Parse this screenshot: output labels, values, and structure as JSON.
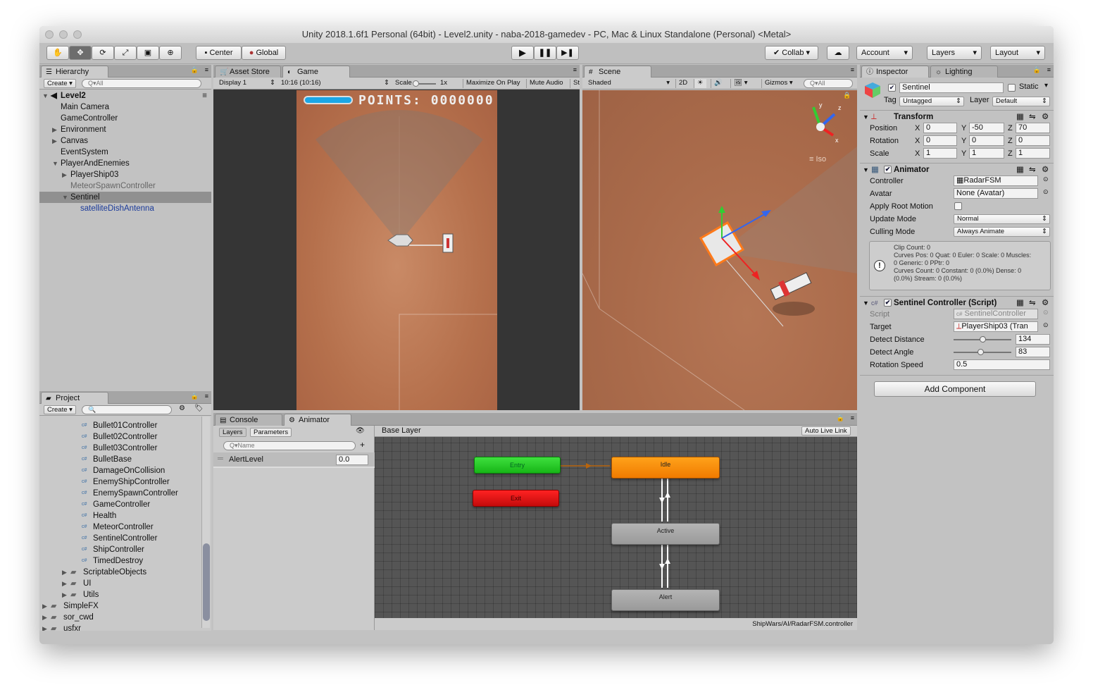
{
  "window": {
    "title": "Unity 2018.1.6f1 Personal (64bit) - Level2.unity - naba-2018-gamedev - PC, Mac & Linux Standalone (Personal) <Metal>"
  },
  "toolbar": {
    "center_label": "Center",
    "global_label": "Global",
    "collab_label": "Collab",
    "account_label": "Account",
    "layers_label": "Layers",
    "layout_label": "Layout"
  },
  "hierarchy": {
    "tab": "Hierarchy",
    "create": "Create",
    "search_placeholder": "Q▾All",
    "scene_name": "Level2",
    "items": [
      {
        "label": "Main Camera"
      },
      {
        "label": "GameController"
      },
      {
        "label": "Environment"
      },
      {
        "label": "Canvas"
      },
      {
        "label": "EventSystem"
      },
      {
        "label": "PlayerAndEnemies"
      },
      {
        "label": "PlayerShip03"
      },
      {
        "label": "MeteorSpawnController"
      },
      {
        "label": "Sentinel"
      },
      {
        "label": "satelliteDishAntenna"
      }
    ]
  },
  "project": {
    "tab": "Project",
    "create": "Create",
    "items": [
      {
        "label": "Bullet01Controller"
      },
      {
        "label": "Bullet02Controller"
      },
      {
        "label": "Bullet03Controller"
      },
      {
        "label": "BulletBase"
      },
      {
        "label": "DamageOnCollision"
      },
      {
        "label": "EnemyShipController"
      },
      {
        "label": "EnemySpawnController"
      },
      {
        "label": "GameController"
      },
      {
        "label": "Health"
      },
      {
        "label": "MeteorController"
      },
      {
        "label": "SentinelController"
      },
      {
        "label": "ShipController"
      },
      {
        "label": "TimedDestroy"
      },
      {
        "label": "ScriptableObjects"
      },
      {
        "label": "UI"
      },
      {
        "label": "Utils"
      },
      {
        "label": "SimpleFX"
      },
      {
        "label": "sor_cwd"
      },
      {
        "label": "usfxr"
      }
    ]
  },
  "game": {
    "tab_asset_store": "Asset Store",
    "tab_game": "Game",
    "display": "Display 1",
    "resolution": "10:16 (10:16)",
    "scale_label": "Scale",
    "scale_value": "1x",
    "maximize": "Maximize On Play",
    "mute": "Mute Audio",
    "stats": "St",
    "points_label": "POINTS:",
    "points_value": "0000000"
  },
  "scene": {
    "tab": "Scene",
    "shading": "Shaded",
    "mode_2d": "2D",
    "gizmos": "Gizmos",
    "search": "Q▾All",
    "view_mode": "Iso",
    "axis_y": "y",
    "axis_z": "z",
    "axis_x": "x"
  },
  "console_tab": "Console",
  "animator": {
    "tab": "Animator",
    "layers_tab": "Layers",
    "parameters_tab": "Parameters",
    "name_placeholder": "Q▾Name",
    "param_name": "AlertLevel",
    "param_value": "0.0",
    "base_layer": "Base Layer",
    "auto_live_link": "Auto Live Link",
    "path": "ShipWars/AI/RadarFSM.controller",
    "states": {
      "entry": "Entry",
      "exit": "Exit",
      "idle": "Idle",
      "active": "Active",
      "alert": "Alert"
    }
  },
  "inspector": {
    "tab": "Inspector",
    "lighting_tab": "Lighting",
    "object_name": "Sentinel",
    "static_label": "Static",
    "tag_label": "Tag",
    "tag_value": "Untagged",
    "layer_label": "Layer",
    "layer_value": "Default",
    "transform": {
      "title": "Transform",
      "position_label": "Position",
      "rotation_label": "Rotation",
      "scale_label": "Scale",
      "px": "0",
      "py": "-50",
      "pz": "70",
      "rx": "0",
      "ry": "0",
      "rz": "0",
      "sx": "1",
      "sy": "1",
      "sz": "1"
    },
    "animator": {
      "title": "Animator",
      "controller_label": "Controller",
      "controller_value": "RadarFSM",
      "avatar_label": "Avatar",
      "avatar_value": "None (Avatar)",
      "root_motion_label": "Apply Root Motion",
      "update_mode_label": "Update Mode",
      "update_mode_value": "Normal",
      "culling_mode_label": "Culling Mode",
      "culling_mode_value": "Always Animate",
      "info_lines": [
        "Clip Count: 0",
        "Curves Pos: 0 Quat: 0 Euler: 0 Scale: 0 Muscles:",
        "0 Generic: 0 PPtr: 0",
        "Curves Count: 0 Constant: 0 (0.0%) Dense: 0",
        "(0.0%) Stream: 0 (0.0%)"
      ]
    },
    "sentinel": {
      "title": "Sentinel Controller (Script)",
      "script_label": "Script",
      "script_value": "SentinelController",
      "target_label": "Target",
      "target_value": "PlayerShip03 (Tran",
      "detect_distance_label": "Detect Distance",
      "detect_distance_value": "134",
      "detect_distance_frac": 0.5,
      "detect_angle_label": "Detect Angle",
      "detect_angle_value": "83",
      "detect_angle_frac": 0.46,
      "rotation_speed_label": "Rotation Speed",
      "rotation_speed_value": "0.5"
    },
    "add_component": "Add Component"
  }
}
